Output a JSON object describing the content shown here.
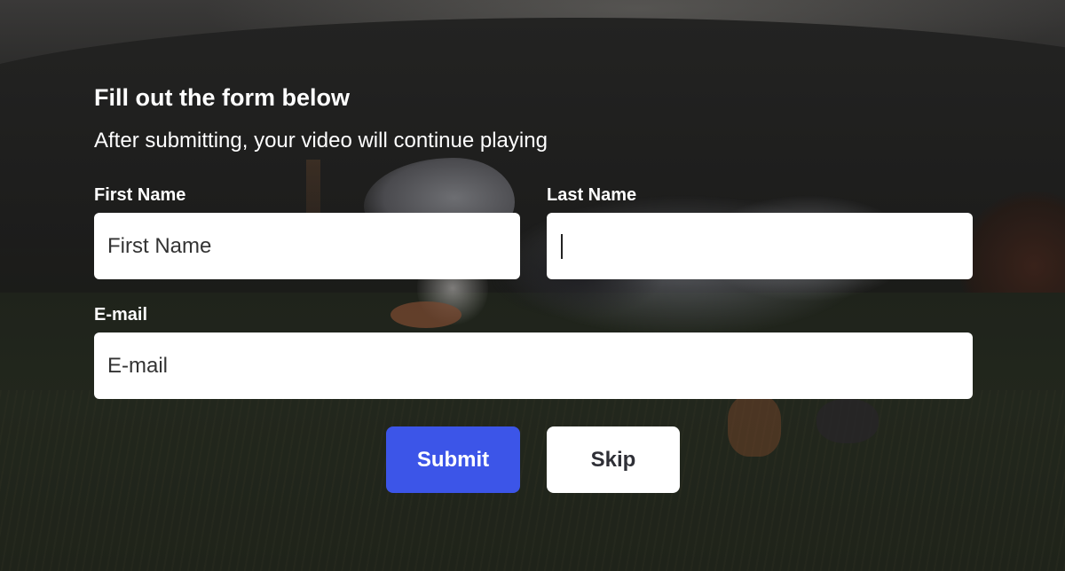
{
  "form": {
    "title": "Fill out the form below",
    "subtitle": "After submitting, your video will continue playing",
    "fields": {
      "first_name": {
        "label": "First Name",
        "placeholder": "First Name",
        "value": ""
      },
      "last_name": {
        "label": "Last Name",
        "placeholder": "",
        "value": ""
      },
      "email": {
        "label": "E-mail",
        "placeholder": "E-mail",
        "value": ""
      }
    },
    "buttons": {
      "submit_label": "Submit",
      "skip_label": "Skip"
    }
  },
  "colors": {
    "submit_button": "#3c55e8",
    "overlay_text": "#ffffff",
    "input_background": "#ffffff"
  }
}
